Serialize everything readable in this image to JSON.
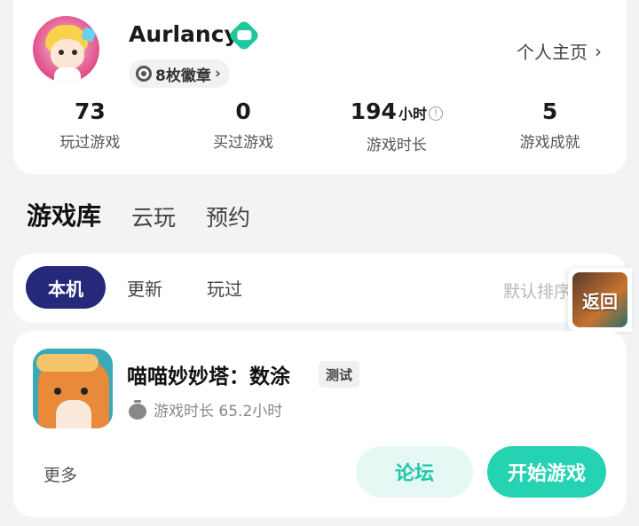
{
  "profile": {
    "username": "Aurlancy",
    "badges_label": "8枚徽章",
    "home_label": "个人主页",
    "stats": [
      {
        "value": "73",
        "unit": "",
        "label": "玩过游戏"
      },
      {
        "value": "0",
        "unit": "",
        "label": "买过游戏"
      },
      {
        "value": "194",
        "unit": "小时",
        "label": "游戏时长"
      },
      {
        "value": "5",
        "unit": "",
        "label": "游戏成就"
      }
    ]
  },
  "tabs": [
    "游戏库",
    "云玩",
    "预约"
  ],
  "filters": {
    "chips": [
      "本机",
      "更新",
      "玩过"
    ],
    "sort_label": "默认排序"
  },
  "floating": {
    "back_label": "返回"
  },
  "game": {
    "title": "喵喵妙妙塔：数涂",
    "tag": "测试",
    "playtime": "游戏时长 65.2小时",
    "more_label": "更多",
    "forum_label": "论坛",
    "start_label": "开始游戏"
  },
  "colors": {
    "accent": "#25d3b2",
    "active_chip": "#26287a",
    "background": "#f2f3f5"
  }
}
